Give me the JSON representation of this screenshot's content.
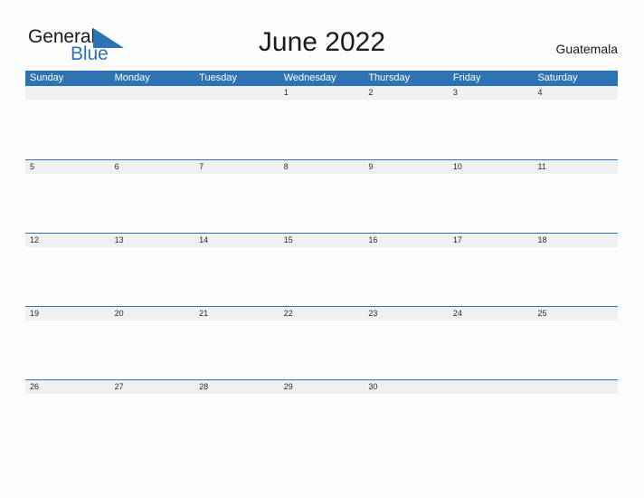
{
  "logo": {
    "word_one": "General",
    "word_two": "Blue",
    "triangle_color": "#2b73b4",
    "text_color": "#1a1a1a"
  },
  "header": {
    "title": "June 2022",
    "country": "Guatemala"
  },
  "theme": {
    "header_blue": "#2e74b5",
    "row_band_gray": "#f0f0f0",
    "page_background": "#fcfcfc",
    "text_dark": "#1a1a1a"
  },
  "calendar": {
    "weekdays": [
      "Sunday",
      "Monday",
      "Tuesday",
      "Wednesday",
      "Thursday",
      "Friday",
      "Saturday"
    ],
    "weeks": [
      [
        "",
        "",
        "",
        "1",
        "2",
        "3",
        "4"
      ],
      [
        "5",
        "6",
        "7",
        "8",
        "9",
        "10",
        "11"
      ],
      [
        "12",
        "13",
        "14",
        "15",
        "16",
        "17",
        "18"
      ],
      [
        "19",
        "20",
        "21",
        "22",
        "23",
        "24",
        "25"
      ],
      [
        "26",
        "27",
        "28",
        "29",
        "30",
        "",
        ""
      ]
    ]
  },
  "chart_data": {
    "type": "table",
    "title": "June 2022",
    "subtitle": "Guatemala",
    "categories": [
      "Sunday",
      "Monday",
      "Tuesday",
      "Wednesday",
      "Thursday",
      "Friday",
      "Saturday"
    ],
    "values": [
      [
        "",
        "",
        "",
        1,
        2,
        3,
        4
      ],
      [
        5,
        6,
        7,
        8,
        9,
        10,
        11
      ],
      [
        12,
        13,
        14,
        15,
        16,
        17,
        18
      ],
      [
        19,
        20,
        21,
        22,
        23,
        24,
        25
      ],
      [
        26,
        27,
        28,
        29,
        30,
        "",
        ""
      ]
    ],
    "xlabel": "",
    "ylabel": "",
    "grid": true,
    "legend": "none"
  }
}
